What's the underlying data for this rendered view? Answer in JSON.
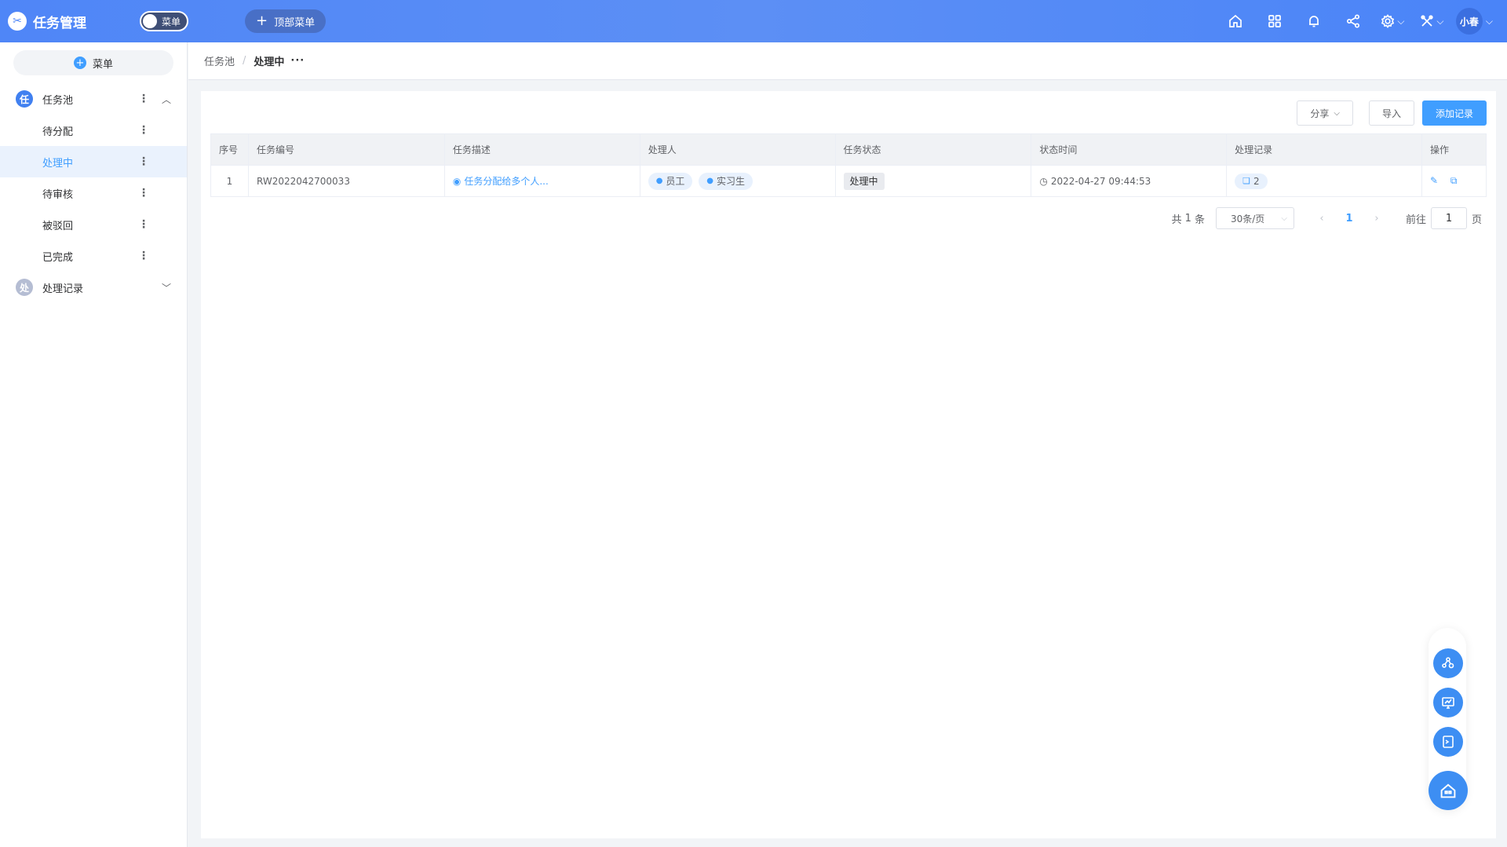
{
  "app": {
    "title": "任务管理",
    "logo_glyph": "✂"
  },
  "topbar": {
    "menu_toggle_label": "菜单",
    "top_menu_label": "顶部菜单",
    "user_name": "小春",
    "icons": [
      "home-icon",
      "apps-icon",
      "bell-icon",
      "share-icon",
      "settings-icon",
      "tools-icon"
    ]
  },
  "sidebar": {
    "add_label": "菜单",
    "groups": [
      {
        "badge": "任",
        "label": "任务池",
        "expanded": true,
        "items": [
          {
            "label": "待分配"
          },
          {
            "label": "处理中",
            "active": true
          },
          {
            "label": "待审核"
          },
          {
            "label": "被驳回"
          },
          {
            "label": "已完成"
          }
        ]
      },
      {
        "badge": "处",
        "label": "处理记录",
        "expanded": false
      }
    ]
  },
  "breadcrumb": {
    "parent": "任务池",
    "current": "处理中",
    "more": "···"
  },
  "toolbar": {
    "share_label": "分享",
    "import_label": "导入",
    "add_label": "添加记录"
  },
  "table": {
    "headers": [
      "序号",
      "任务编号",
      "任务描述",
      "处理人",
      "任务状态",
      "状态时间",
      "处理记录",
      "操作"
    ],
    "rows": [
      {
        "index": "1",
        "task_no": "RW2022042700033",
        "description": "任务分配给多个人...",
        "assignees": [
          "员工",
          "实习生"
        ],
        "status": "处理中",
        "status_time": "2022-04-27 09:44:53",
        "records": "2"
      }
    ]
  },
  "pagination": {
    "total_prefix": "共",
    "total": "1",
    "total_suffix": "条",
    "page_size": "30条/页",
    "current_page": "1",
    "goto_prefix": "前往",
    "goto_value": "1",
    "goto_suffix": "页"
  },
  "colors": {
    "primary": "#409eff",
    "topbar": "#4f86f7",
    "active_bg": "#eaf2fd"
  }
}
